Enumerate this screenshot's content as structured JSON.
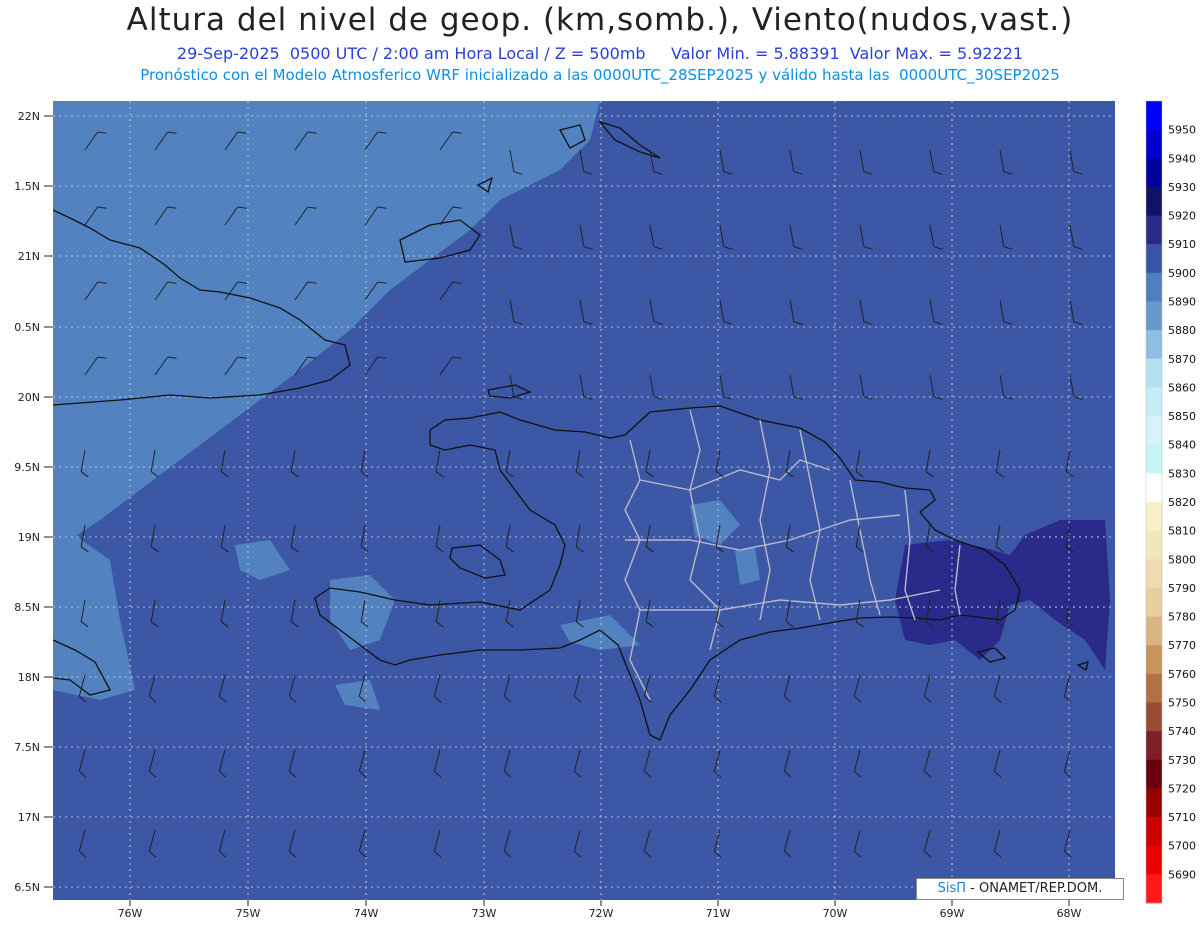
{
  "header": {
    "title": "Altura del nivel de geop. (km,somb.), Viento(nudos,vast.)",
    "subtitle_line1": "29-Sep-2025  0500 UTC / 2:00 am Hora Local / Z = 500mb     Valor Min. = 5.88391  Valor Max. = 5.92221",
    "subtitle_line2": "Pronóstico con el Modelo Atmosferico WRF inicializado a las 0000UTC_28SEP2025 y válido hasta las  0000UTC_30SEP2025"
  },
  "axes": {
    "lat_labels": [
      "22N",
      "1.5N",
      "21N",
      "0.5N",
      "20N",
      "9.5N",
      "19N",
      "8.5N",
      "18N",
      "7.5N",
      "17N",
      "6.5N"
    ],
    "lon_labels": [
      "76W",
      "75W",
      "74W",
      "73W",
      "72W",
      "71W",
      "70W",
      "69W",
      "68W"
    ]
  },
  "colorbar": {
    "labels": [
      "5950",
      "5940",
      "5930",
      "5920",
      "5910",
      "5900",
      "5890",
      "5880",
      "5870",
      "5860",
      "5850",
      "5840",
      "5830",
      "5820",
      "5810",
      "5800",
      "5790",
      "5780",
      "5770",
      "5760",
      "5750",
      "5740",
      "5730",
      "5720",
      "5710",
      "5700",
      "5690"
    ],
    "colors": [
      "#0000ff",
      "#0000cc",
      "#000099",
      "#111166",
      "#2a2a8a",
      "#3a55a8",
      "#4f7fbf",
      "#6699cc",
      "#8fbfe0",
      "#b5e0ef",
      "#c8ecf4",
      "#d9f2f8",
      "#c6f4f4",
      "#ffffff",
      "#f7f0c8",
      "#f2e6bc",
      "#eedcb0",
      "#e8cfa0",
      "#d9b585",
      "#c8955f",
      "#b27144",
      "#9a4b33",
      "#7f1e26",
      "#6a0010",
      "#990000",
      "#cc0000",
      "#ee0000",
      "#ff1a1a"
    ],
    "level_colors_note": "",
    "dominant_color": "#3b57a5",
    "shelf_color": "#5283c0",
    "light_color": "#6aa0d6",
    "max_color": "#2a2a8a"
  },
  "credit": {
    "brand": "SisΠ",
    "text": "- ONAMET/REP.DOM."
  }
}
